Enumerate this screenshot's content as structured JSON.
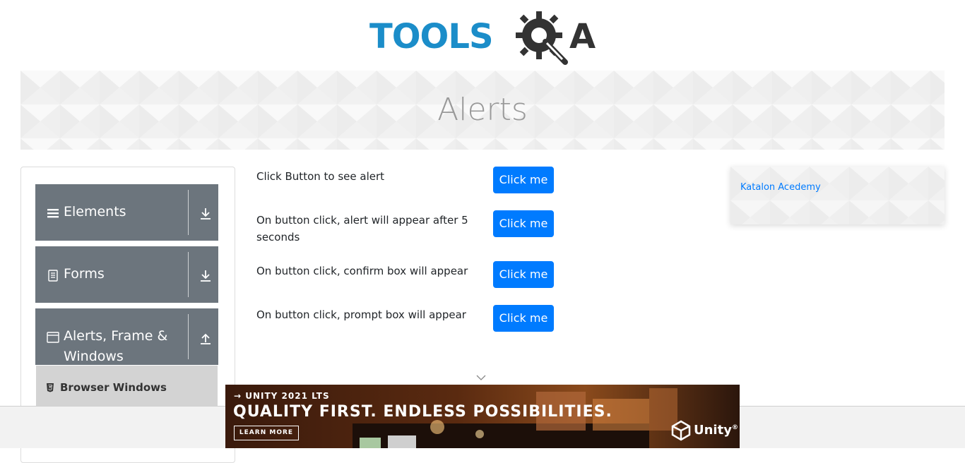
{
  "header": {
    "logo_text_left": "TOOLS",
    "logo_text_right": "A",
    "logo_alt": "TOOLSQA"
  },
  "banner": {
    "title": "Alerts"
  },
  "sidebar": {
    "groups": [
      {
        "label": "Elements",
        "icon": "hamburger-icon",
        "arrow": "download-arrow-icon"
      },
      {
        "label": "Forms",
        "icon": "document-icon",
        "arrow": "download-arrow-icon"
      },
      {
        "label": "Alerts, Frame & Windows",
        "label_line1": "Alerts, Frame &",
        "label_line2": "Windows",
        "icon": "window-icon",
        "arrow": "upload-arrow-icon"
      }
    ],
    "sub_items": [
      {
        "label": "Browser Windows",
        "icon": "html5-icon"
      }
    ]
  },
  "main": {
    "rows": [
      {
        "label": "Click Button to see alert",
        "button": "Click me"
      },
      {
        "label": "On button click, alert will appear after 5 seconds",
        "button": "Click me"
      },
      {
        "label": "On button click, confirm box will appear",
        "button": "Click me"
      },
      {
        "label": "On button click, prompt box will appear",
        "button": "Click me"
      }
    ]
  },
  "right_panel": {
    "link": "Katalon Acedemy"
  },
  "ad": {
    "kicker": "→ UNITY 2021 LTS",
    "headline": "QUALITY FIRST. ENDLESS POSSIBILITIES.",
    "cta": "LEARN MORE",
    "brand": "Unity",
    "brand_mark": "®"
  },
  "colors": {
    "brand_blue": "#1b8dc9",
    "sidebar_group": "#6c757d",
    "button": "#007bff",
    "sub_item_bg": "#d3d3d3"
  }
}
